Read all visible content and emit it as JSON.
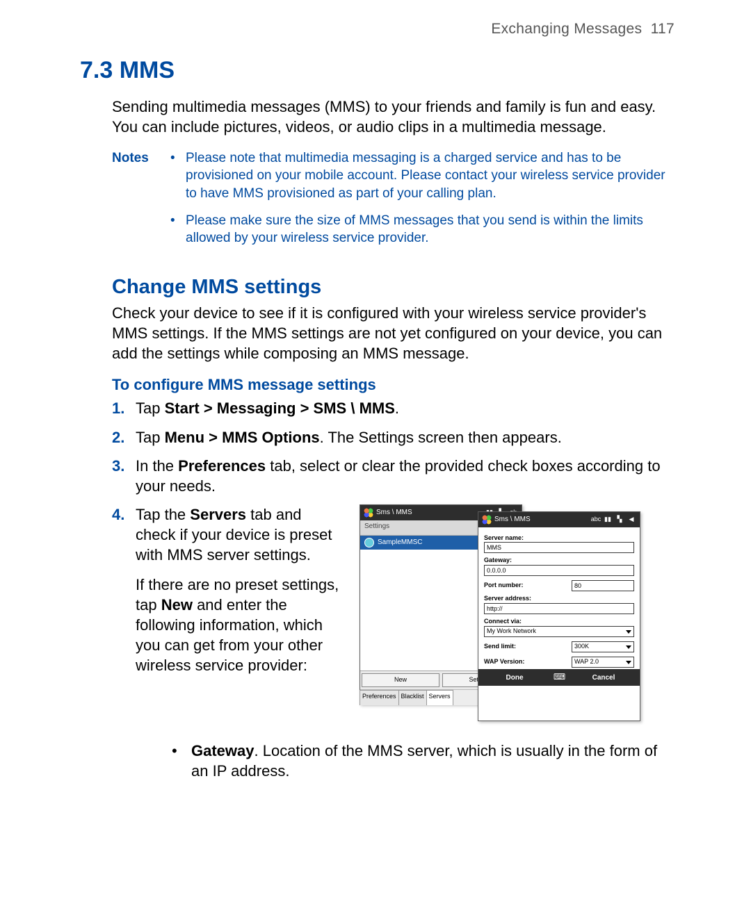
{
  "header": {
    "chapter": "Exchanging Messages",
    "page": "117"
  },
  "h1": "7.3 MMS",
  "intro": "Sending multimedia messages (MMS) to your friends and family is fun and easy. You can include pictures, videos, or audio clips in a multimedia message.",
  "notes_label": "Notes",
  "notes": [
    "Please note that multimedia messaging is a charged service and has to be provisioned on your mobile account. Please contact your wireless service provider to have MMS provisioned as part of your calling plan.",
    "Please make sure the size of MMS messages that you send is within the limits allowed by your wireless service provider."
  ],
  "h2": "Change MMS settings",
  "h2_body": "Check your device to see if it is configured with your wireless service provider's MMS settings. If the MMS settings are not yet configured on your device, you can add the settings while composing an MMS message.",
  "h3": "To configure MMS message settings",
  "steps": {
    "n1": "1.",
    "s1_pre": "Tap ",
    "s1_bold": "Start > Messaging > SMS \\ MMS",
    "s1_post": ".",
    "n2": "2.",
    "s2_pre": "Tap ",
    "s2_bold": "Menu > MMS Options",
    "s2_post": ". The Settings screen then appears.",
    "n3": "3.",
    "s3_pre": "In the ",
    "s3_bold": "Preferences",
    "s3_post": " tab, select or clear the provided check boxes according to your needs.",
    "n4": "4.",
    "s4a_pre": "Tap the ",
    "s4a_bold": "Servers",
    "s4a_post": " tab and check if your device is preset with MMS server settings.",
    "s4b_pre": "If there are no preset settings, tap ",
    "s4b_bold": "New",
    "s4b_post": " and enter the following information, which you can get from your other wireless service provider:"
  },
  "gateway": {
    "label": "Gateway",
    "text": ". Location of the MMS server, which is usually in the form of an IP address."
  },
  "screens": {
    "left": {
      "title": "Sms \\ MMS",
      "status_ok": "ok",
      "settings_label": "Settings",
      "server_item": "SampleMMSC",
      "btn_new": "New",
      "btn_setdefault": "Set As D",
      "tabs": [
        "Preferences",
        "Blacklist",
        "Servers"
      ]
    },
    "right": {
      "title": "Sms \\ MMS",
      "status_abc": "abc",
      "labels": {
        "server_name": "Server name:",
        "gateway": "Gateway:",
        "port": "Port number:",
        "server_addr": "Server address:",
        "connect_via": "Connect via:",
        "send_limit": "Send limit:",
        "wap_version": "WAP Version:"
      },
      "values": {
        "server_name": "MMS",
        "gateway": "0.0.0.0",
        "port": "80",
        "server_addr": "http://",
        "connect_via": "My Work Network",
        "send_limit": "300K",
        "wap_version": "WAP 2.0"
      },
      "softkeys": {
        "done": "Done",
        "cancel": "Cancel"
      }
    }
  }
}
